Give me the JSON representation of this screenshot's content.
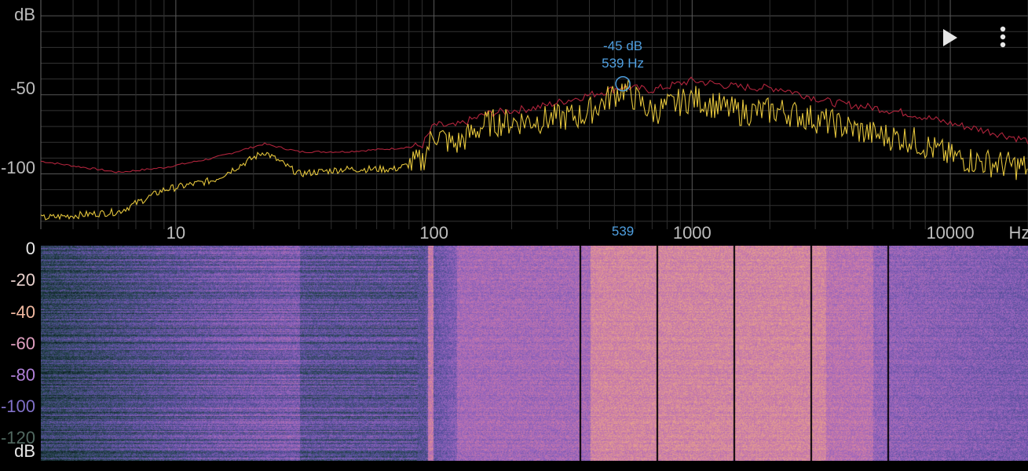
{
  "spectrum": {
    "y_unit": "dB",
    "y_ticks": [
      "-50",
      "-100"
    ],
    "x_ticks": [
      {
        "label": "10",
        "hz": 10
      },
      {
        "label": "100",
        "hz": 100
      },
      {
        "label": "1000",
        "hz": 1000
      },
      {
        "label": "10000",
        "hz": 10000
      }
    ],
    "x_unit": "Hz",
    "peak": {
      "db_text": "-45 dB",
      "hz_text": "539 Hz",
      "marker_text": "539",
      "hz": 539,
      "db": -45
    },
    "x_range_hz": [
      3,
      20000
    ],
    "y_range_db": [
      -135,
      5
    ],
    "colors": {
      "grid": "#3a3a3a",
      "peak_hold": "#b0243c",
      "live": "#e3c43c",
      "accent": "#4f9fe0"
    }
  },
  "spectrogram": {
    "scale_labels": [
      {
        "text": "0",
        "color": "#e8e8e8"
      },
      {
        "text": "-20",
        "color": "#e8d0cc"
      },
      {
        "text": "-40",
        "color": "#f0b8a0"
      },
      {
        "text": "-60",
        "color": "#e0a0c0"
      },
      {
        "text": "-80",
        "color": "#b080d8"
      },
      {
        "text": "-100",
        "color": "#8070c8"
      },
      {
        "text": "-120",
        "color": "#506860"
      }
    ],
    "unit": "dB"
  },
  "toolbar": {
    "play_icon": "play-icon",
    "menu_icon": "more-vert-icon"
  },
  "chart_data": {
    "type": "line",
    "xlabel": "Hz",
    "ylabel": "dB",
    "x_scale": "log",
    "xlim": [
      3,
      20000
    ],
    "ylim": [
      -135,
      5
    ],
    "grid": true,
    "series": [
      {
        "values_x": [
          3,
          6,
          9,
          14,
          22,
          30,
          45,
          70,
          90,
          100,
          120,
          160,
          250,
          380,
          539,
          700,
          1000,
          1500,
          2200,
          3500,
          5000,
          7000,
          10000,
          14000,
          20000
        ],
        "values_y": [
          -92,
          -99,
          -96,
          -90,
          -81,
          -86,
          -86,
          -84,
          -82,
          -69,
          -70,
          -62,
          -58,
          -51,
          -45,
          -47,
          -41,
          -45,
          -46,
          -55,
          -58,
          -62,
          -68,
          -73,
          -79
        ]
      },
      {
        "values_x": [
          3,
          6,
          9,
          14,
          22,
          30,
          45,
          70,
          90,
          100,
          120,
          160,
          250,
          380,
          539,
          700,
          1000,
          1500,
          2200,
          3500,
          5000,
          7000,
          10000,
          14000,
          20000
        ],
        "values_y": [
          -128,
          -124,
          -110,
          -104,
          -86,
          -100,
          -97,
          -97,
          -92,
          -74,
          -82,
          -68,
          -66,
          -63,
          -46,
          -61,
          -52,
          -61,
          -60,
          -68,
          -75,
          -78,
          -89,
          -93,
          -96
        ]
      }
    ]
  }
}
